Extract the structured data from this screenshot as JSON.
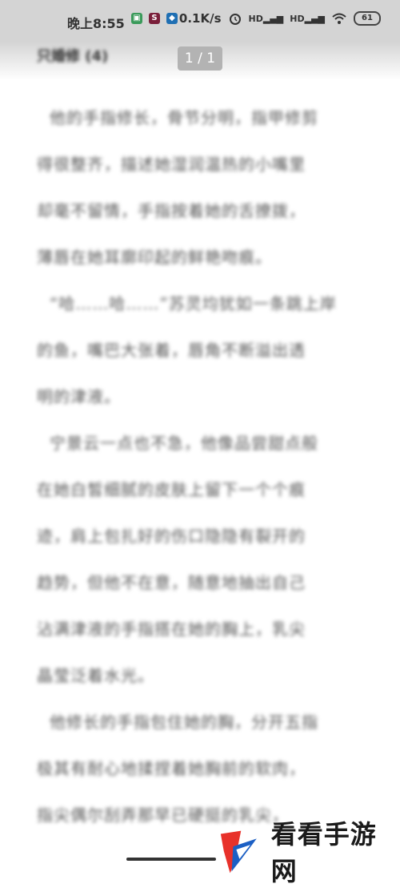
{
  "status_bar": {
    "time": "晚上8:55",
    "app_icons": [
      {
        "name": "gallery-app-icon",
        "glyph": "▣",
        "color": "#3a9a5a"
      },
      {
        "name": "s-app-icon",
        "glyph": "S",
        "color": "#7a1f3a"
      },
      {
        "name": "shield-app-icon",
        "glyph": "◆",
        "color": "#1f6fb3"
      }
    ],
    "net_speed": "0.1K/s",
    "signal_label_1": "HD",
    "signal_label_2": "HD",
    "battery": "61"
  },
  "header": {
    "chapter_title": "只婚修 (4)",
    "page_indicator": "1 / 1"
  },
  "content": {
    "lines": [
      "他的手指修长，骨节分明，指甲修剪",
      "得很整齐，描述她湿润温热的小嘴里",
      "却毫不留情，手指按着她的舌撩拨，",
      "薄唇在她耳廓印起的鲜艳吻痕。",
      "“哈……哈……”苏灵均犹如一条跳上岸",
      "的鱼，嘴巴大张着，唇角不断溢出透",
      "明的津液。",
      "宁景云一点也不急，他像品尝甜点般",
      "在她白皙细腻的皮肤上留下一个个痕",
      "迹，肩上包扎好的伤口隐隐有裂开的",
      "趋势，但他不在意，随意地抽出自己",
      "沾满津液的手指搭在她的胸上，乳尖",
      "晶莹泛着水光。",
      "他修长的手指包住她的胸，分开五指",
      "极其有耐心地揉捏着她胸前的软肉，",
      "指尖偶尔刮弄那早已硬挺的乳尖，"
    ],
    "indented_lines": [
      0,
      4,
      7,
      13
    ]
  },
  "watermark": {
    "text": "看看手游网",
    "logo_colors": {
      "primary": "#e8312a",
      "secondary": "#1b5fc4"
    }
  }
}
